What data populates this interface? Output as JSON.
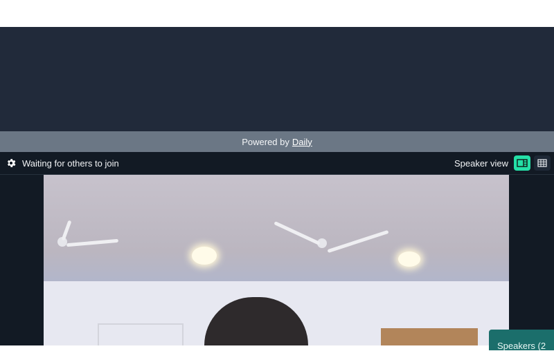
{
  "footer": {
    "powered_text": "Powered by",
    "powered_link": "Daily"
  },
  "call_bar": {
    "settings_icon": "gear-icon",
    "status_text": "Waiting for others to join",
    "view_label": "Speaker view",
    "speaker_view_icon": "speaker-layout-icon",
    "grid_view_icon": "grid-layout-icon",
    "active_color": "#24e0a7"
  },
  "sidebar_tab": {
    "label": "Speakers (2"
  },
  "colors": {
    "dark_bg": "#212a3a",
    "call_bg": "#121a24",
    "powered_bg": "#6b7785"
  }
}
